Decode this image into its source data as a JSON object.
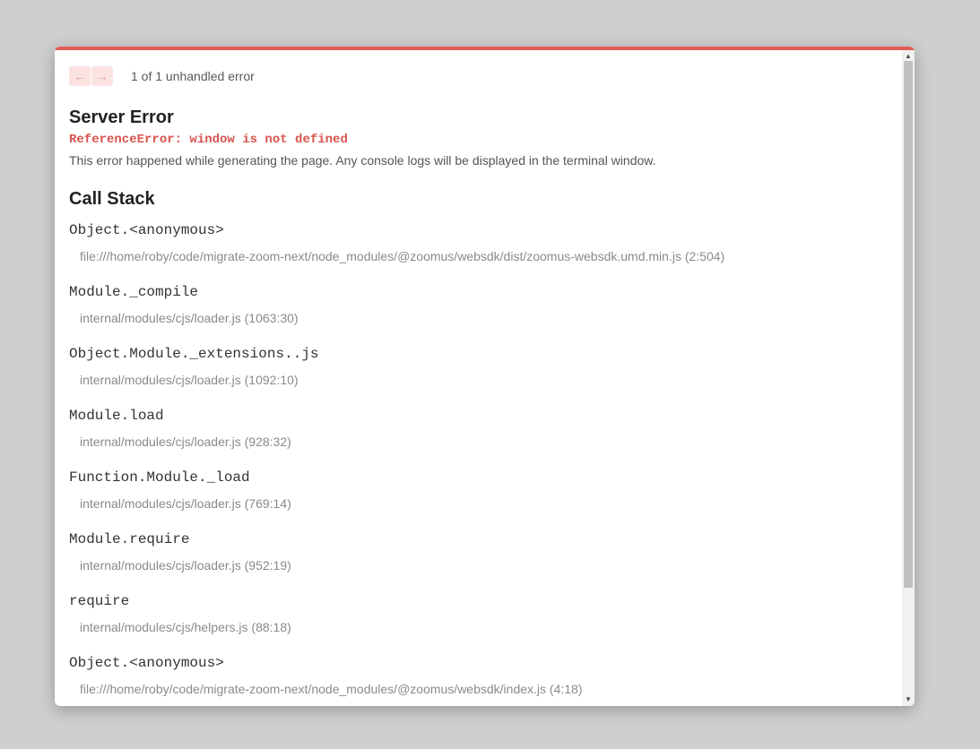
{
  "nav": {
    "prev_icon": "arrow-left-icon",
    "next_icon": "arrow-right-icon",
    "prev_glyph": "←",
    "next_glyph": "→",
    "count_text": "1 of 1 unhandled error"
  },
  "error": {
    "title": "Server Error",
    "name": "ReferenceError: window is not defined",
    "description": "This error happened while generating the page. Any console logs will be displayed in the terminal window."
  },
  "callstack": {
    "title": "Call Stack",
    "frames": [
      {
        "fn": "Object.<anonymous>",
        "loc": "file:///home/roby/code/migrate-zoom-next/node_modules/@zoomus/websdk/dist/zoomus-websdk.umd.min.js (2:504)"
      },
      {
        "fn": "Module._compile",
        "loc": "internal/modules/cjs/loader.js (1063:30)"
      },
      {
        "fn": "Object.Module._extensions..js",
        "loc": "internal/modules/cjs/loader.js (1092:10)"
      },
      {
        "fn": "Module.load",
        "loc": "internal/modules/cjs/loader.js (928:32)"
      },
      {
        "fn": "Function.Module._load",
        "loc": "internal/modules/cjs/loader.js (769:14)"
      },
      {
        "fn": "Module.require",
        "loc": "internal/modules/cjs/loader.js (952:19)"
      },
      {
        "fn": "require",
        "loc": "internal/modules/cjs/helpers.js (88:18)"
      },
      {
        "fn": "Object.<anonymous>",
        "loc": "file:///home/roby/code/migrate-zoom-next/node_modules/@zoomus/websdk/index.js (4:18)"
      }
    ]
  },
  "colors": {
    "accent": "#e05d55",
    "error_text": "#d9544d",
    "backdrop": "#cfcfcf"
  }
}
